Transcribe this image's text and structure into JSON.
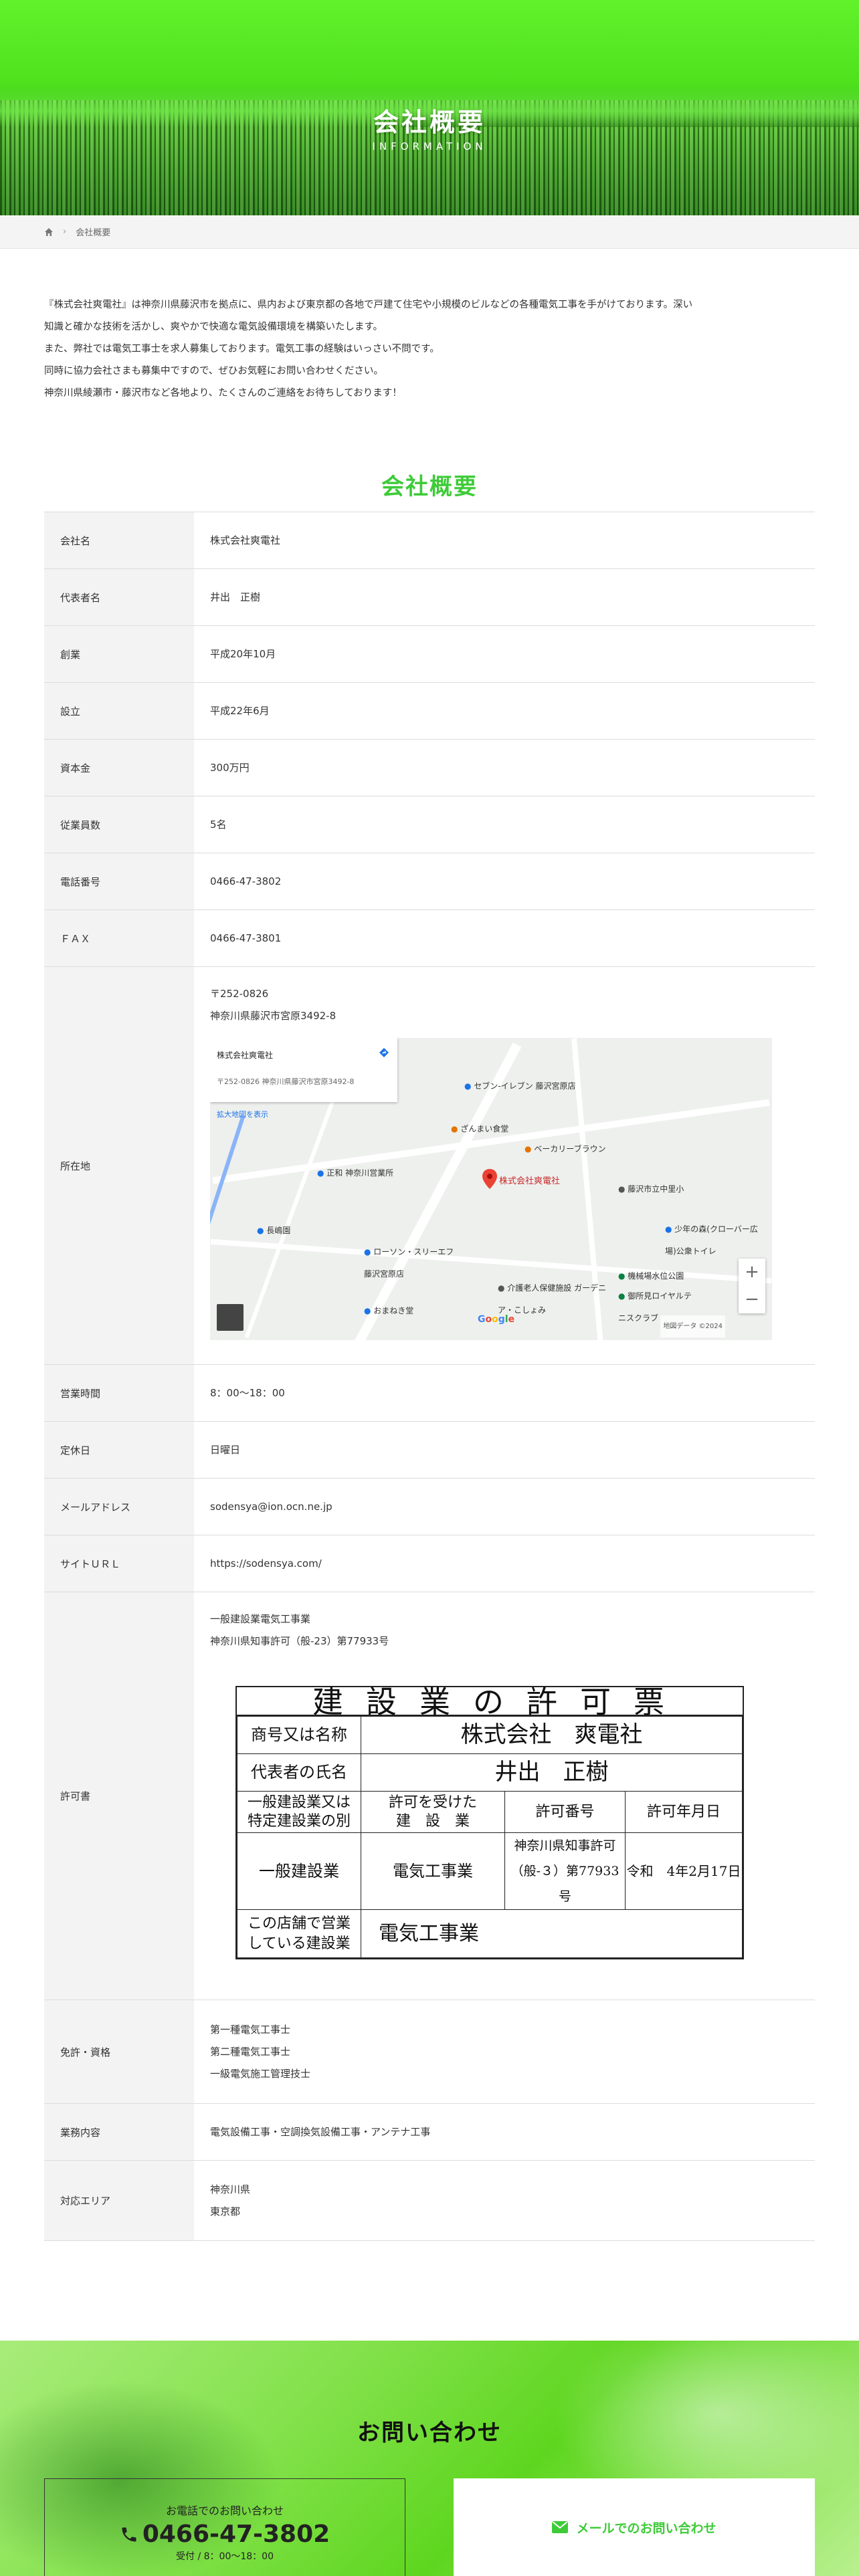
{
  "hero": {
    "title": "会社概要",
    "subtitle": "INFORMATION"
  },
  "breadcrumb": {
    "current": "会社概要"
  },
  "intro": {
    "lines": [
      "『株式会社爽電社』は神奈川県藤沢市を拠点に、県内および東京都の各地で戸建て住宅や小規模のビルなどの各種電気工事を手がけております。深い",
      "知識と確かな技術を活かし、爽やかで快適な電気設備環境を構築いたします。",
      "また、弊社では電気工事士を求人募集しております。電気工事の経験はいっさい不問です。",
      "同時に協力会社さまも募集中ですので、ぜひお気軽にお問い合わせください。",
      "神奈川県綾瀬市・藤沢市など各地より、たくさんのご連絡をお待ちしております！"
    ]
  },
  "section_title": "会社概要",
  "table": {
    "company_name": {
      "label": "会社名",
      "value": "株式会社爽電社"
    },
    "representative": {
      "label": "代表者名",
      "value": "井出　正樹"
    },
    "founded": {
      "label": "創業",
      "value": "平成20年10月"
    },
    "established": {
      "label": "設立",
      "value": "平成22年6月"
    },
    "capital": {
      "label": "資本金",
      "value": "300万円"
    },
    "employees": {
      "label": "従業員数",
      "value": "5名"
    },
    "phone": {
      "label": "電話番号",
      "value": "0466-47-3802"
    },
    "fax": {
      "label": "ＦＡＸ",
      "value": "0466-47-3801"
    },
    "address": {
      "label": "所在地",
      "postal": "〒252-0826",
      "street": "神奈川県藤沢市宮原3492-8"
    },
    "hours": {
      "label": "営業時間",
      "value": "8：00〜18：00"
    },
    "holiday": {
      "label": "定休日",
      "value": "日曜日"
    },
    "email": {
      "label": "メールアドレス",
      "value": "sodensya@ion.ocn.ne.jp"
    },
    "site": {
      "label": "サイトＵＲＬ",
      "value": "https://sodensya.com/"
    },
    "permit": {
      "label": "許可書",
      "line1": "一般建設業電気工事業",
      "line2": "神奈川県知事許可（般-23）第77933号"
    },
    "licenses": {
      "label": "免許・資格",
      "items": [
        "第一種電気工事士",
        "第二種電気工事士",
        "一級電気施工管理技士"
      ]
    },
    "business": {
      "label": "業務内容",
      "value": "電気設備工事・空調換気設備工事・アンテナ工事"
    },
    "area": {
      "label": "対応エリア",
      "items": [
        "神奈川県",
        "東京都"
      ]
    }
  },
  "map": {
    "pin_label": "株式会社爽電社",
    "info_title": "株式会社爽電社",
    "info_address": "〒252-0826 神奈川県藤沢市宮原3492-8",
    "info_link": "拡大地図を表示",
    "pois": [
      {
        "name": "セブン-イレブン 藤沢宮原店",
        "color": "#1a73e8"
      },
      {
        "name": "ざんまい食堂",
        "color": "#e37400"
      },
      {
        "name": "ベーカリーブラウン",
        "color": "#e37400"
      },
      {
        "name": "正和 神奈川営業所",
        "color": "#1a73e8"
      },
      {
        "name": "藤沢市立中里小",
        "color": "#555555"
      },
      {
        "name": "長嶋園",
        "color": "#1a73e8"
      },
      {
        "name": "ローソン・スリーエフ 藤沢宮原店",
        "color": "#1a73e8"
      },
      {
        "name": "介護老人保健施設 ガーデニア・こしょみ",
        "color": "#555555"
      },
      {
        "name": "おまねき堂",
        "color": "#1a73e8"
      },
      {
        "name": "少年の森(クローバー広場)公衆トイレ",
        "color": "#1a73e8"
      },
      {
        "name": "機械場水位公園",
        "color": "#0b8043"
      },
      {
        "name": "御所見ロイヤルテニスクラブ",
        "color": "#0b8043"
      }
    ],
    "google_logo": "Google",
    "footer": "地図データ ©2024"
  },
  "certificate": {
    "title": "建設業の許可票",
    "trade_name_label": "商号又は名称",
    "trade_name": "株式会社　爽電社",
    "rep_label": "代表者の氏名",
    "rep_name": "井出　正樹",
    "type_label_1": "一般建設業又は",
    "type_label_2": "特定建設業の別",
    "permit_work_label_1": "許可を受けた",
    "permit_work_label_2": "建　設　業",
    "permit_no_label": "許可番号",
    "permit_date_label": "許可年月日",
    "type_value": "一般建設業",
    "work_value": "電気工事業",
    "permit_no_1": "神奈川県知事許可",
    "permit_no_2": "（般-３）第77933号",
    "permit_date": "令和　4年2月17日",
    "store_label_1": "この店舗で営業",
    "store_label_2": "している建設業",
    "store_value": "電気工事業"
  },
  "contact": {
    "title": "お問い合わせ",
    "tel_caption": "お電話でのお問い合わせ",
    "tel_number": "0466-47-3802",
    "tel_hours": "受付 / 8：00〜18：00",
    "mail_label": "メールでのお問い合わせ"
  },
  "colors": {
    "accent": "#3ecb38",
    "hero": "#4fe21d"
  }
}
